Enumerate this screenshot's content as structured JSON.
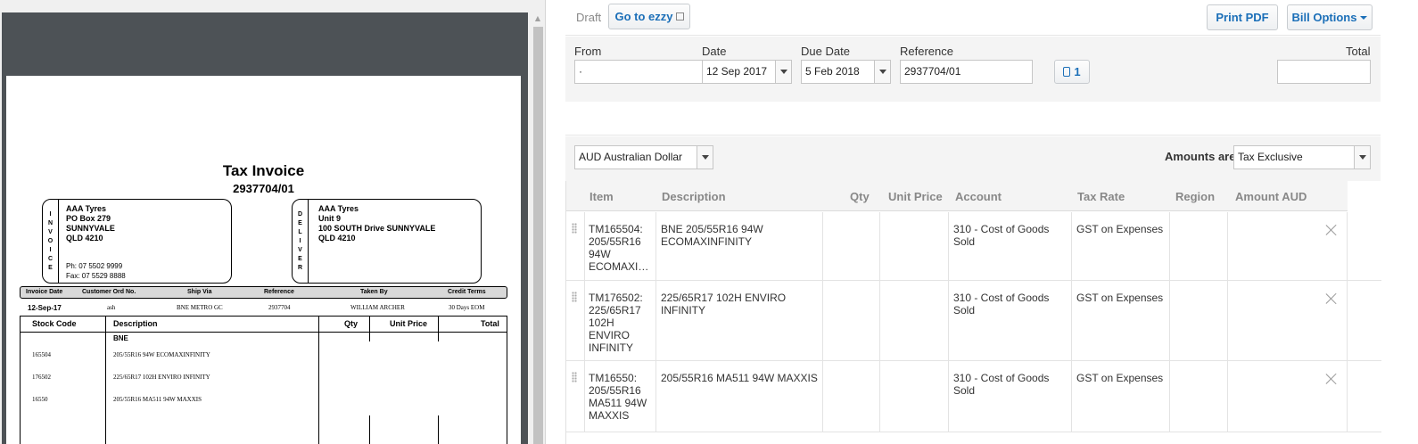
{
  "document": {
    "title": "Tax Invoice",
    "number": "2937704/01",
    "invoice_side": [
      "I",
      "N",
      "V",
      "O",
      "I",
      "C",
      "E"
    ],
    "invoice_address": [
      "AAA Tyres",
      "PO Box 279",
      "SUNNYVALE",
      "QLD 4210"
    ],
    "phone": "Ph:    07 5502 9999",
    "fax": "Fax:  07 5529 8888",
    "deliver_side": [
      "D",
      "E",
      "L",
      "I",
      "V",
      "E",
      "R"
    ],
    "deliver_address": [
      "AAA Tyres",
      "Unit 9",
      "100 SOUTH Drive SUNNYVALE",
      "QLD 4210"
    ],
    "meta_headers": [
      "Invoice Date",
      "Customer Ord No.",
      "Ship Via",
      "Reference",
      "Taken By",
      "Credit Terms"
    ],
    "meta_values": [
      "12-Sep-17",
      "ash",
      "BNE METRO GC",
      "2937704",
      "WILLIAM ARCHER",
      "30 Days EOM"
    ],
    "line_headers": [
      "Stock Code",
      "Description",
      "Qty",
      "Unit Price",
      "Total"
    ],
    "line_group": "BNE",
    "lines": [
      {
        "code": "165504",
        "desc": "205/55R16 94W ECOMAXINFINITY"
      },
      {
        "code": "176502",
        "desc": "225/65R17 102H ENVIRO INFINITY"
      },
      {
        "code": "16550",
        "desc": "205/55R16 MA511 94W MAXXIS"
      }
    ]
  },
  "editor": {
    "status": "Draft",
    "go_ezzy": "Go to ezzy",
    "print_pdf": "Print PDF",
    "bill_options": "Bill Options",
    "from_label": "From",
    "from_value": "·",
    "date_label": "Date",
    "date_value": "12 Sep 2017",
    "due_label": "Due Date",
    "due_value": "5 Feb 2018",
    "ref_label": "Reference",
    "ref_value": "2937704/01",
    "attachments_count": "1",
    "total_label": "Total",
    "total_value": "",
    "currency": "AUD Australian Dollar",
    "amounts_label": "Amounts are",
    "amounts_value": "Tax Exclusive",
    "columns": [
      "Item",
      "Description",
      "Qty",
      "Unit Price",
      "Account",
      "Tax Rate",
      "Region",
      "Amount AUD"
    ],
    "rows": [
      {
        "item": "TM165504: 205/55R16 94W ECOMAXI…",
        "description": "BNE 205/55R16 94W ECOMAXINFINITY",
        "account": "310 - Cost of Goods Sold",
        "tax": "GST on Expenses"
      },
      {
        "item": "TM176502: 225/65R17 102H ENVIRO INFINITY",
        "description": "225/65R17 102H ENVIRO INFINITY",
        "account": "310 - Cost of Goods Sold",
        "tax": "GST on Expenses"
      },
      {
        "item": "TM16550: 205/55R16 MA511 94W MAXXIS",
        "description": "205/55R16 MA511 94W MAXXIS",
        "account": "310 - Cost of Goods Sold",
        "tax": "GST on Expenses"
      }
    ]
  }
}
